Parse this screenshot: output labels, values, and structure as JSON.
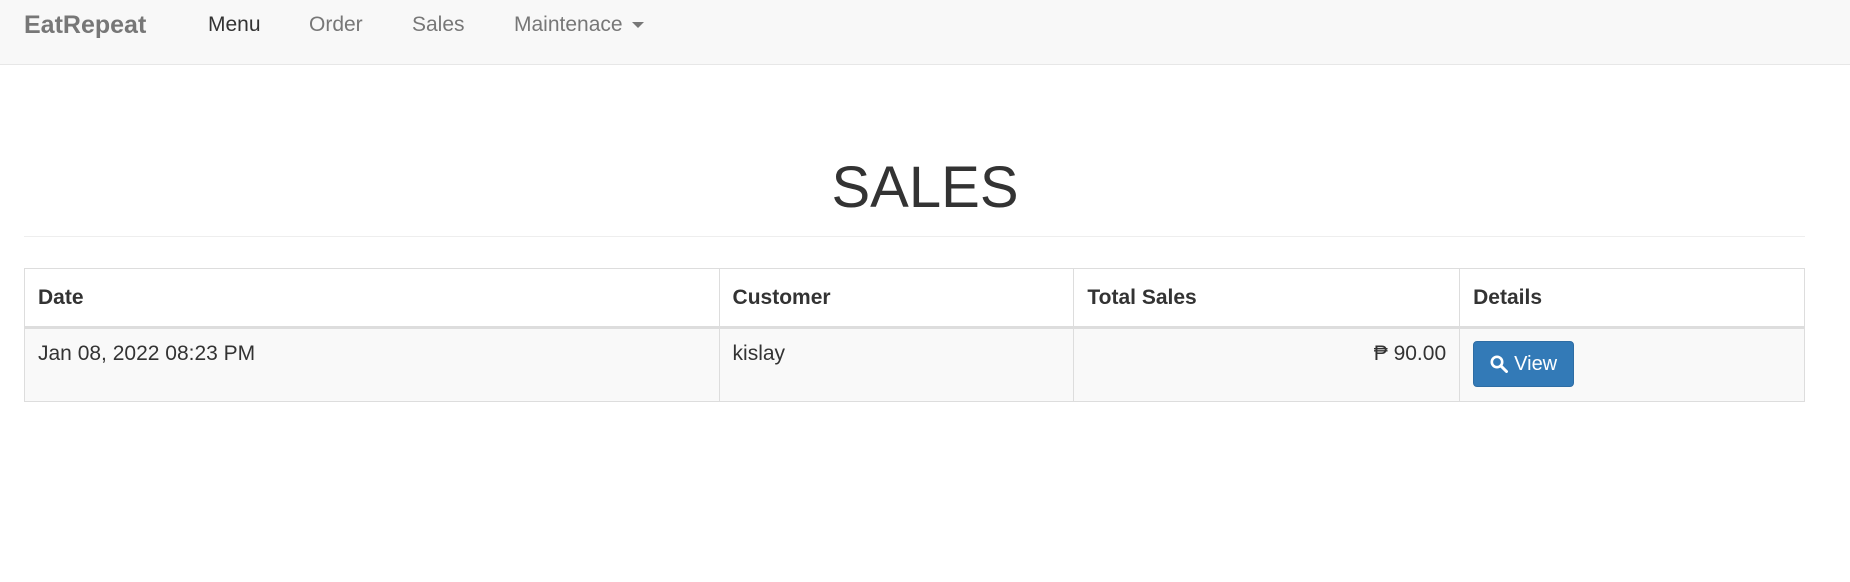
{
  "navbar": {
    "brand": "EatRepeat",
    "items": [
      {
        "label": "Menu",
        "active": true
      },
      {
        "label": "Order",
        "active": false
      },
      {
        "label": "Sales",
        "active": false
      },
      {
        "label": "Maintenace",
        "active": false,
        "dropdown": true
      }
    ]
  },
  "page": {
    "title": "SALES"
  },
  "table": {
    "headers": [
      "Date",
      "Customer",
      "Total Sales",
      "Details"
    ],
    "rows": [
      {
        "date": "Jan 08, 2022 08:23 PM",
        "customer": "kislay",
        "total": "₱ 90.00",
        "action_label": "View",
        "action_icon": "search-icon"
      }
    ]
  },
  "colors": {
    "navbar_bg": "#f8f8f8",
    "primary_button": "#337ab7",
    "row_stripe": "#f9f9f9"
  }
}
